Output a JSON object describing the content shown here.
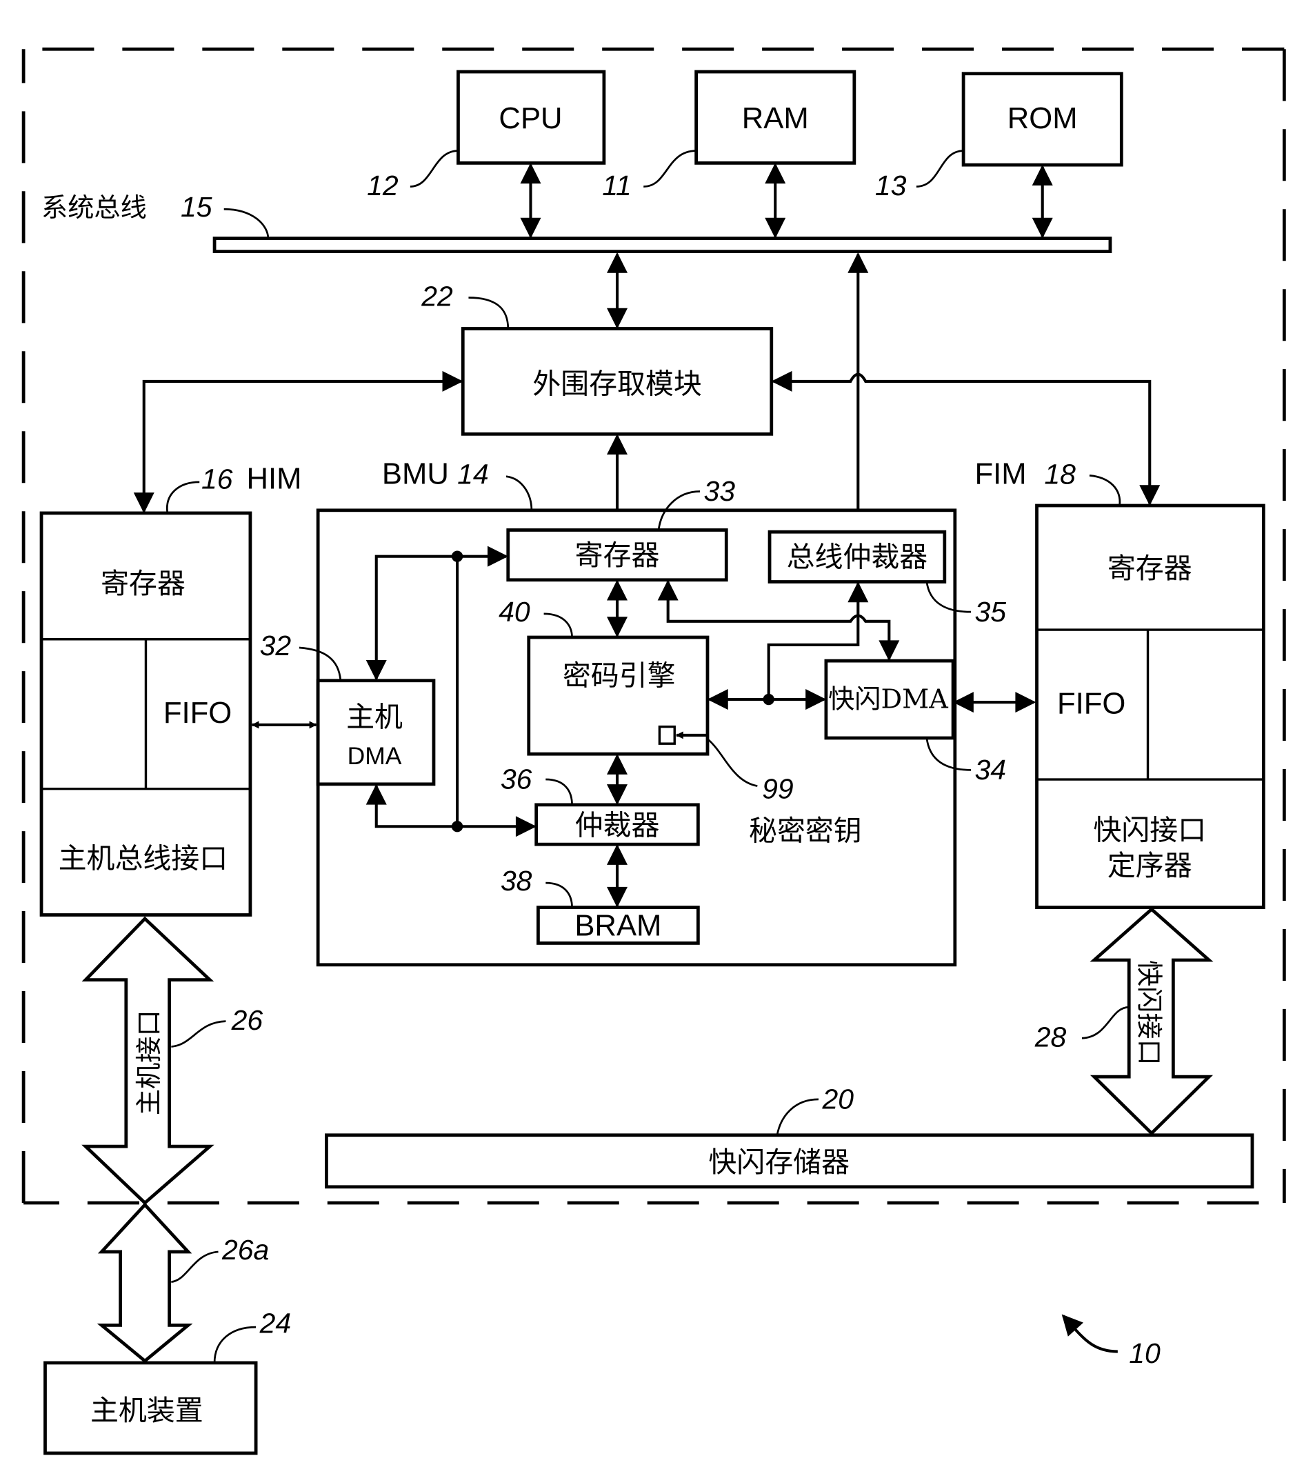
{
  "figure": {
    "ref": "10",
    "system_bus": {
      "label": "系统总线",
      "ref": "15"
    },
    "cpu": {
      "label": "CPU",
      "ref": "12"
    },
    "ram": {
      "label": "RAM",
      "ref": "11"
    },
    "rom": {
      "label": "ROM",
      "ref": "13"
    },
    "peripheral_access": {
      "label": "外围存取模块",
      "ref": "22"
    },
    "him": {
      "ref": "16",
      "name": "HIM",
      "registers": "寄存器",
      "fifo": "FIFO",
      "bus_interface": "主机总线接口"
    },
    "bmu": {
      "name": "BMU",
      "ref": "14",
      "registers": {
        "label": "寄存器",
        "ref": "33"
      },
      "bus_arbiter": {
        "label": "总线仲裁器",
        "ref": "35"
      },
      "crypto_engine": {
        "label": "密码引擎",
        "ref": "40"
      },
      "host_dma": {
        "line1": "主机",
        "line2": "DMA",
        "ref": "32"
      },
      "flash_dma": {
        "label": "快闪DMA",
        "ref": "34"
      },
      "arbiter": {
        "label": "仲裁器",
        "ref": "36"
      },
      "bram": {
        "label": "BRAM",
        "ref": "38"
      },
      "secret_key": {
        "label": "秘密密钥",
        "ref": "99"
      }
    },
    "fim": {
      "name": "FIM",
      "ref": "18",
      "registers": "寄存器",
      "fifo": "FIFO",
      "sequencer_line1": "快闪接口",
      "sequencer_line2": "定序器"
    },
    "host_interface": {
      "label": "主机接口",
      "ref": "26"
    },
    "host_link": {
      "ref": "26a"
    },
    "host_device": {
      "label": "主机装置",
      "ref": "24"
    },
    "flash_interface": {
      "label": "快闪接口",
      "ref": "28"
    },
    "flash_memory": {
      "label": "快闪存储器",
      "ref": "20"
    }
  }
}
